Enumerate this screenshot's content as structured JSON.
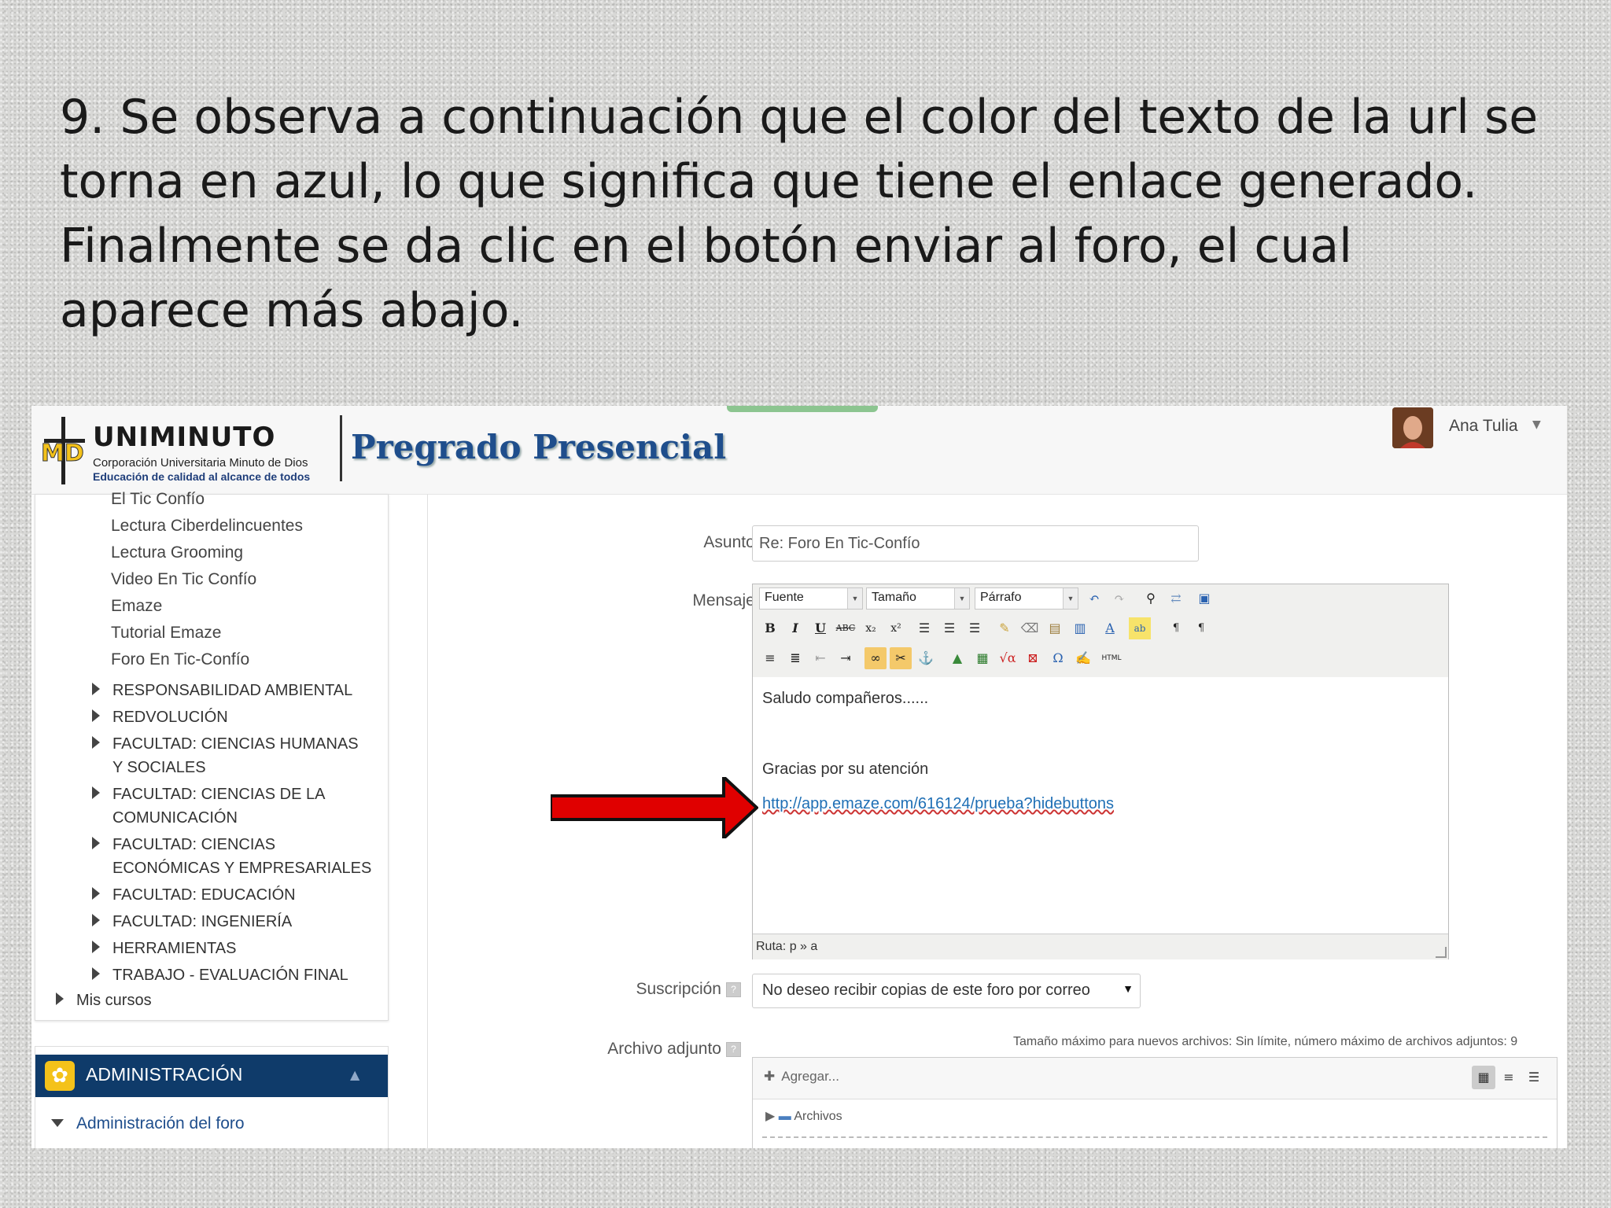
{
  "slide": {
    "text": "9. Se observa a continuación que el color del texto de la url se torna en azul, lo que significa que tiene el enlace generado. Finalmente se da clic en el botón enviar al foro, el cual aparece más abajo."
  },
  "header": {
    "logo_word": "UNIMINUTO",
    "logo_sub1": "Corporación Universitaria Minuto de Dios",
    "logo_sub2": "Educación de calidad al alcance de todos",
    "site_title": "Pregrado Presencial",
    "user_name": "Ana Tulia"
  },
  "sidebar": {
    "activities": [
      "El Tic Confío",
      "Lectura Ciberdelincuentes",
      "Lectura Grooming",
      "Video En Tic Confío",
      "Emaze",
      "Tutorial Emaze",
      "Foro En Tic-Confío"
    ],
    "categories": [
      "RESPONSABILIDAD AMBIENTAL",
      "REDVOLUCIÓN",
      "FACULTAD: CIENCIAS HUMANAS Y SOCIALES",
      "FACULTAD: CIENCIAS DE LA COMUNICACIÓN",
      "FACULTAD: CIENCIAS ECONÓMICAS Y EMPRESARIALES",
      "FACULTAD: EDUCACIÓN",
      "FACULTAD: INGENIERÍA",
      "HERRAMIENTAS",
      "TRABAJO - EVALUACIÓN FINAL"
    ],
    "mis_cursos": "Mis cursos",
    "admin_title": "ADMINISTRACIÓN",
    "admin_link": "Administración del foro"
  },
  "form": {
    "asunto_label": "Asunto",
    "asunto_value": "Re: Foro En Tic-Confío",
    "mensaje_label": "Mensaje",
    "required_mark": "*",
    "toolbar": {
      "font": "Fuente",
      "size": "Tamaño",
      "format": "Párrafo"
    },
    "message_lines": [
      "Saludo compañeros......",
      "Gracias por su atención"
    ],
    "message_link": "http://app.emaze.com/616124/prueba?hidebuttons",
    "status_path": "Ruta: p » a",
    "suscripcion_label": "Suscripción",
    "suscripcion_value": "No deseo recibir copias de este foro por correo",
    "archivo_label": "Archivo adjunto",
    "file_note": "Tamaño máximo para nuevos archivos: Sin límite, número máximo de archivos adjuntos: 9",
    "add_label": "Agregar...",
    "folder_label": "Archivos"
  },
  "colors": {
    "link": "#1f6fb5",
    "admin_header": "#0f3b6a",
    "site_title": "#1f4e8c",
    "arrow": "#e00000"
  }
}
